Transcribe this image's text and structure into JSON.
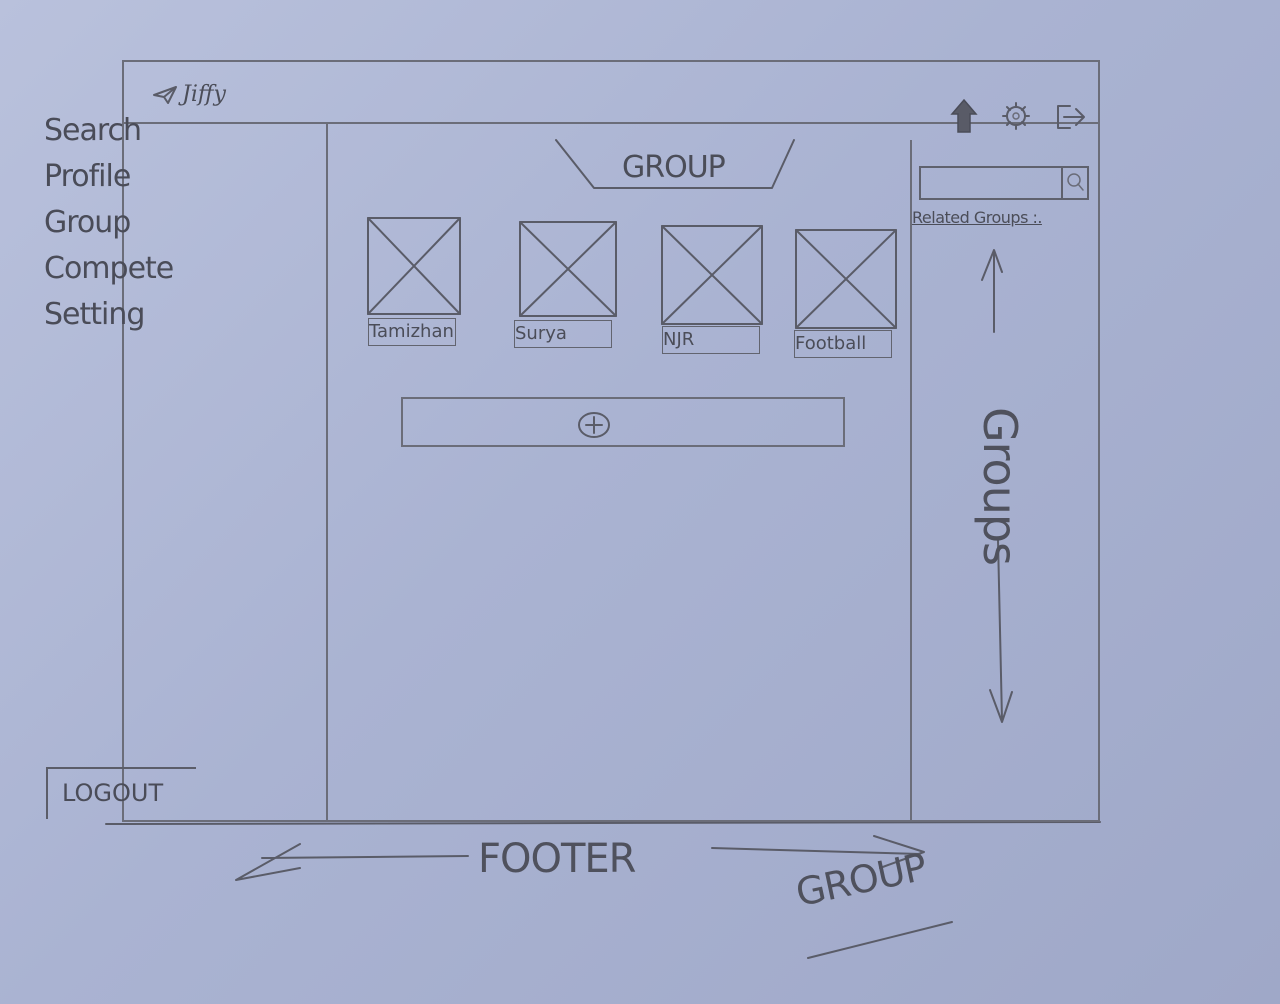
{
  "app": {
    "logo_text": "Jiffy"
  },
  "header": {
    "icons": [
      "home-icon",
      "gear-icon",
      "logout-icon"
    ]
  },
  "sidebar": {
    "items": [
      {
        "label": "Search"
      },
      {
        "label": "Profile"
      },
      {
        "label": "Group"
      },
      {
        "label": "Compete"
      },
      {
        "label": "Setting"
      }
    ],
    "logout_label": "LOGOUT"
  },
  "main": {
    "tab_label": "GROUP",
    "cards": [
      {
        "label": "Tamizhan"
      },
      {
        "label": "Surya"
      },
      {
        "label": "NJR"
      },
      {
        "label": "Football"
      }
    ],
    "add_icon": "plus-circle-icon"
  },
  "right_panel": {
    "search_placeholder": "",
    "related_label": "Related Groups :.",
    "groups_label": "Groups"
  },
  "annotations": {
    "footer": "FOOTER",
    "page_name": "GROUP"
  }
}
